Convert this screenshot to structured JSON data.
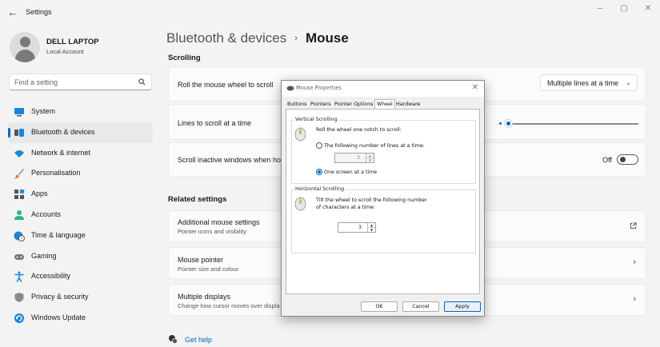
{
  "window": {
    "title": "Settings",
    "back_glyph": "←",
    "minimize_glyph": "–",
    "maximize_glyph": "▢",
    "close_glyph": "✕"
  },
  "profile": {
    "name": "DELL LAPTOP",
    "account_type": "Local Account"
  },
  "search": {
    "placeholder": "Find a setting"
  },
  "nav": {
    "items": [
      {
        "label": "System",
        "icon": "monitor-icon",
        "active": false
      },
      {
        "label": "Bluetooth & devices",
        "icon": "bluetooth-icon",
        "active": true
      },
      {
        "label": "Network & internet",
        "icon": "wifi-icon",
        "active": false
      },
      {
        "label": "Personalisation",
        "icon": "brush-icon",
        "active": false
      },
      {
        "label": "Apps",
        "icon": "apps-icon",
        "active": false
      },
      {
        "label": "Accounts",
        "icon": "person-icon",
        "active": false
      },
      {
        "label": "Time & language",
        "icon": "globe-clock-icon",
        "active": false
      },
      {
        "label": "Gaming",
        "icon": "gamepad-icon",
        "active": false
      },
      {
        "label": "Accessibility",
        "icon": "accessibility-icon",
        "active": false
      },
      {
        "label": "Privacy & security",
        "icon": "shield-icon",
        "active": false
      },
      {
        "label": "Windows Update",
        "icon": "update-icon",
        "active": false
      }
    ]
  },
  "header": {
    "parent": "Bluetooth & devices",
    "separator": "›",
    "current": "Mouse"
  },
  "scrolling": {
    "section_title": "Scrolling",
    "roll_wheel": {
      "label": "Roll the mouse wheel to scroll",
      "value": "Multiple lines at a time",
      "chevron": "⌄"
    },
    "lines_to_scroll": {
      "label": "Lines to scroll at a time",
      "value_fraction": 0.02
    },
    "scroll_inactive": {
      "label": "Scroll inactive windows when hovering over them",
      "visible_label": "Scroll inactive windows when ho",
      "state_label": "Off",
      "on": false
    }
  },
  "related": {
    "section_title": "Related settings",
    "items": [
      {
        "title": "Additional mouse settings",
        "subtitle": "Pointer icons and visibility",
        "action_icon": "open-external-icon"
      },
      {
        "title": "Mouse pointer",
        "subtitle": "Pointer size and colour",
        "action_icon": "chevron-right-icon"
      },
      {
        "title": "Multiple displays",
        "subtitle": "Change how cursor moves over displa",
        "action_icon": "chevron-right-icon"
      }
    ],
    "chevron_glyph": "›"
  },
  "help": {
    "label": "Get help"
  },
  "dialog": {
    "title": "Mouse Properties",
    "close_glyph": "✕",
    "tabs": [
      "Buttons",
      "Pointers",
      "Pointer Options",
      "Wheel",
      "Hardware"
    ],
    "active_tab": "Wheel",
    "vertical": {
      "label": "Vertical Scrolling",
      "description": "Roll the wheel one notch to scroll:",
      "option_lines": "The following number of lines at a time:",
      "lines_value": "3",
      "option_screen": "One screen at a time",
      "selected": "screen"
    },
    "horizontal": {
      "label": "Horizontal Scrolling",
      "description_line1": "Tilt the wheel to scroll the following number",
      "description_line2": "of characters at a time:",
      "chars_value": "3"
    },
    "spin_up_glyph": "▲",
    "spin_down_glyph": "▼",
    "buttons": {
      "ok": "OK",
      "cancel": "Cancel",
      "apply": "Apply"
    }
  },
  "colors": {
    "accent": "#0067c0",
    "background": "#f3f3f3",
    "card": "#fbfbfb"
  }
}
